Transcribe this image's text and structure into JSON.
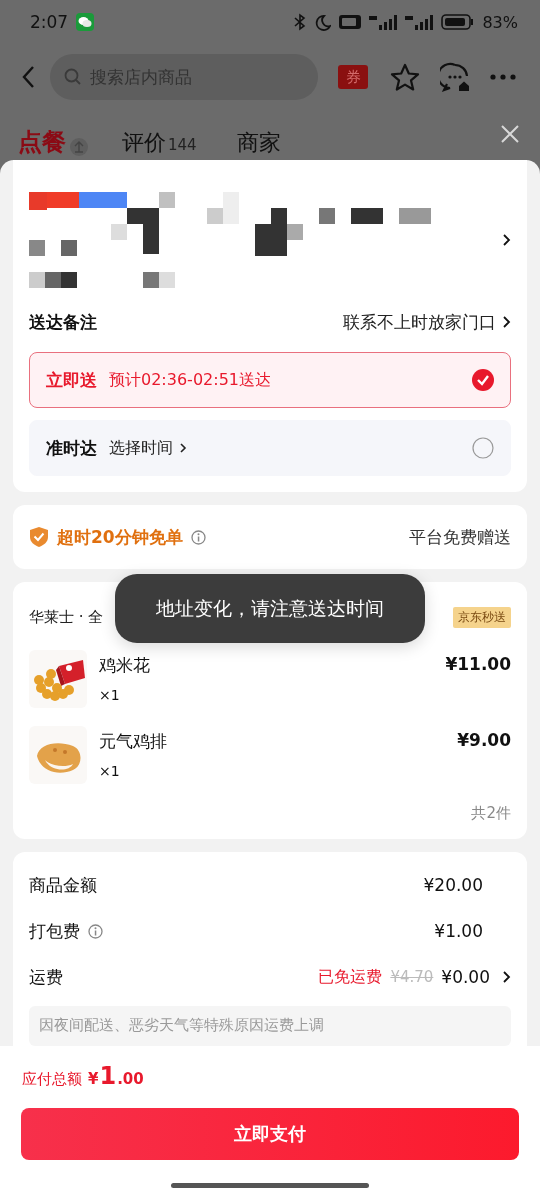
{
  "status_bar": {
    "time": "2:07",
    "battery": "83%"
  },
  "header": {
    "search": {
      "placeholder": "搜索店内商品"
    },
    "coupon": "券"
  },
  "tabs": [
    {
      "label": "点餐",
      "selected": true
    },
    {
      "label": "评价",
      "count": "144",
      "selected": false
    },
    {
      "label": "商家",
      "selected": false
    }
  ],
  "delivery": {
    "note_label": "送达备注",
    "note_value": "联系不上时放家门口",
    "options": [
      {
        "title": "立即送",
        "detail": "预计02:36-02:51送达",
        "selected": true
      },
      {
        "title": "准时达",
        "detail": "选择时间",
        "selected": false
      }
    ]
  },
  "guarantee": {
    "label": "超时20分钟免单",
    "value": "平台免费赠送"
  },
  "order": {
    "store": "华莱士 · 全",
    "badge": "京东秒送",
    "items": [
      {
        "name": "鸡米花",
        "qty": "×1",
        "price": "¥11.00",
        "kind": "picture"
      },
      {
        "name": "元气鸡排",
        "qty": "×1",
        "price": "¥9.00",
        "kind": "picture"
      }
    ],
    "count": "共2件"
  },
  "fees": {
    "rows": [
      {
        "label": "商品金额",
        "value": "¥20.00",
        "kind": "plain"
      },
      {
        "label": "打包费",
        "value": "¥1.00",
        "kind": "info"
      },
      {
        "label": "运费",
        "value": "¥0.00",
        "kind": "discount",
        "tag": "已免运费",
        "original": "¥4.70"
      }
    ],
    "notice": "因夜间配送、恶劣天气等特殊原因运费上调"
  },
  "total": {
    "label": "应付总额",
    "currency": "¥",
    "integer": "1",
    "decimal": ".00"
  },
  "pay_button": "立即支付",
  "toast": "地址变化，请注意送达时间"
}
